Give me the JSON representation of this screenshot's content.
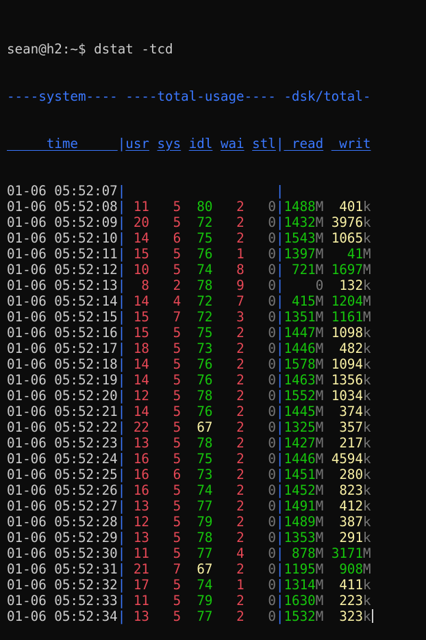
{
  "prompt": "sean@h2:~$",
  "command": "dstat -tcd",
  "colors": {
    "background": "#0c0c0c",
    "header": "#3b78ff",
    "red": "#e74856",
    "green": "#16c60c",
    "yellow": "#f9f1a5",
    "gray": "#767676",
    "white": "#cccccc"
  },
  "header1": [
    {
      "text": "----system----",
      "color": "blue"
    },
    {
      "text": " ",
      "color": "white"
    },
    {
      "text": "----total-usage----",
      "color": "blue"
    },
    {
      "text": " ",
      "color": "white"
    },
    {
      "text": "-dsk/total-",
      "color": "blue"
    }
  ],
  "header2": [
    {
      "text": "     time     ",
      "color": "blue",
      "u": true
    },
    {
      "text": "|",
      "color": "blue"
    },
    {
      "text": "usr",
      "color": "blue",
      "u": true
    },
    {
      "text": " ",
      "color": "white"
    },
    {
      "text": "sys",
      "color": "blue",
      "u": true
    },
    {
      "text": " ",
      "color": "white"
    },
    {
      "text": "idl",
      "color": "blue",
      "u": true
    },
    {
      "text": " ",
      "color": "white"
    },
    {
      "text": "wai",
      "color": "blue",
      "u": true
    },
    {
      "text": " ",
      "color": "white"
    },
    {
      "text": "stl",
      "color": "blue",
      "u": true
    },
    {
      "text": "|",
      "color": "blue"
    },
    {
      "text": " read",
      "color": "blue",
      "u": true
    },
    {
      "text": " ",
      "color": "white"
    },
    {
      "text": " writ",
      "color": "blue",
      "u": true
    }
  ],
  "rows": [
    {
      "time": "01-06 05:52:07",
      "usr": "",
      "sys": "",
      "idl": "",
      "wai": "",
      "stl": "",
      "read": "",
      "writ": ""
    },
    {
      "time": "01-06 05:52:08",
      "usr": "11",
      "sys": "5",
      "idl": "80",
      "wai": "2",
      "stl": "0",
      "read": "1488M",
      "writ": "401k"
    },
    {
      "time": "01-06 05:52:09",
      "usr": "20",
      "sys": "5",
      "idl": "72",
      "wai": "2",
      "stl": "0",
      "read": "1432M",
      "writ": "3976k"
    },
    {
      "time": "01-06 05:52:10",
      "usr": "14",
      "sys": "6",
      "idl": "75",
      "wai": "2",
      "stl": "0",
      "read": "1543M",
      "writ": "1065k"
    },
    {
      "time": "01-06 05:52:11",
      "usr": "15",
      "sys": "5",
      "idl": "76",
      "wai": "1",
      "stl": "0",
      "read": "1397M",
      "writ": "41M"
    },
    {
      "time": "01-06 05:52:12",
      "usr": "10",
      "sys": "5",
      "idl": "74",
      "wai": "8",
      "stl": "0",
      "read": "721M",
      "writ": "1697M"
    },
    {
      "time": "01-06 05:52:13",
      "usr": "8",
      "sys": "2",
      "idl": "78",
      "wai": "9",
      "stl": "0",
      "read": "0",
      "writ": "132k"
    },
    {
      "time": "01-06 05:52:14",
      "usr": "14",
      "sys": "4",
      "idl": "72",
      "wai": "7",
      "stl": "0",
      "read": "415M",
      "writ": "1204M"
    },
    {
      "time": "01-06 05:52:15",
      "usr": "15",
      "sys": "7",
      "idl": "72",
      "wai": "3",
      "stl": "0",
      "read": "1351M",
      "writ": "1161M"
    },
    {
      "time": "01-06 05:52:16",
      "usr": "15",
      "sys": "5",
      "idl": "75",
      "wai": "2",
      "stl": "0",
      "read": "1447M",
      "writ": "1098k"
    },
    {
      "time": "01-06 05:52:17",
      "usr": "18",
      "sys": "5",
      "idl": "73",
      "wai": "2",
      "stl": "0",
      "read": "1446M",
      "writ": "482k"
    },
    {
      "time": "01-06 05:52:18",
      "usr": "14",
      "sys": "5",
      "idl": "76",
      "wai": "2",
      "stl": "0",
      "read": "1578M",
      "writ": "1094k"
    },
    {
      "time": "01-06 05:52:19",
      "usr": "14",
      "sys": "5",
      "idl": "76",
      "wai": "2",
      "stl": "0",
      "read": "1463M",
      "writ": "1356k"
    },
    {
      "time": "01-06 05:52:20",
      "usr": "12",
      "sys": "5",
      "idl": "78",
      "wai": "2",
      "stl": "0",
      "read": "1552M",
      "writ": "1034k"
    },
    {
      "time": "01-06 05:52:21",
      "usr": "14",
      "sys": "5",
      "idl": "76",
      "wai": "2",
      "stl": "0",
      "read": "1445M",
      "writ": "374k"
    },
    {
      "time": "01-06 05:52:22",
      "usr": "22",
      "sys": "5",
      "idl": "67",
      "wai": "2",
      "stl": "0",
      "read": "1325M",
      "writ": "357k"
    },
    {
      "time": "01-06 05:52:23",
      "usr": "13",
      "sys": "5",
      "idl": "78",
      "wai": "2",
      "stl": "0",
      "read": "1427M",
      "writ": "217k"
    },
    {
      "time": "01-06 05:52:24",
      "usr": "16",
      "sys": "5",
      "idl": "75",
      "wai": "2",
      "stl": "0",
      "read": "1446M",
      "writ": "4594k"
    },
    {
      "time": "01-06 05:52:25",
      "usr": "16",
      "sys": "6",
      "idl": "73",
      "wai": "2",
      "stl": "0",
      "read": "1451M",
      "writ": "280k"
    },
    {
      "time": "01-06 05:52:26",
      "usr": "16",
      "sys": "5",
      "idl": "74",
      "wai": "2",
      "stl": "0",
      "read": "1452M",
      "writ": "823k"
    },
    {
      "time": "01-06 05:52:27",
      "usr": "13",
      "sys": "5",
      "idl": "77",
      "wai": "2",
      "stl": "0",
      "read": "1491M",
      "writ": "412k"
    },
    {
      "time": "01-06 05:52:28",
      "usr": "12",
      "sys": "5",
      "idl": "79",
      "wai": "2",
      "stl": "0",
      "read": "1489M",
      "writ": "387k"
    },
    {
      "time": "01-06 05:52:29",
      "usr": "13",
      "sys": "5",
      "idl": "78",
      "wai": "2",
      "stl": "0",
      "read": "1353M",
      "writ": "291k"
    },
    {
      "time": "01-06 05:52:30",
      "usr": "11",
      "sys": "5",
      "idl": "77",
      "wai": "4",
      "stl": "0",
      "read": "878M",
      "writ": "3171M"
    },
    {
      "time": "01-06 05:52:31",
      "usr": "21",
      "sys": "7",
      "idl": "67",
      "wai": "2",
      "stl": "0",
      "read": "1195M",
      "writ": "908M"
    },
    {
      "time": "01-06 05:52:32",
      "usr": "17",
      "sys": "5",
      "idl": "74",
      "wai": "1",
      "stl": "0",
      "read": "1314M",
      "writ": "411k"
    },
    {
      "time": "01-06 05:52:33",
      "usr": "11",
      "sys": "5",
      "idl": "79",
      "wai": "2",
      "stl": "0",
      "read": "1630M",
      "writ": "223k"
    },
    {
      "time": "01-06 05:52:34",
      "usr": "13",
      "sys": "5",
      "idl": "77",
      "wai": "2",
      "stl": "0",
      "read": "1532M",
      "writ": "323k"
    }
  ]
}
